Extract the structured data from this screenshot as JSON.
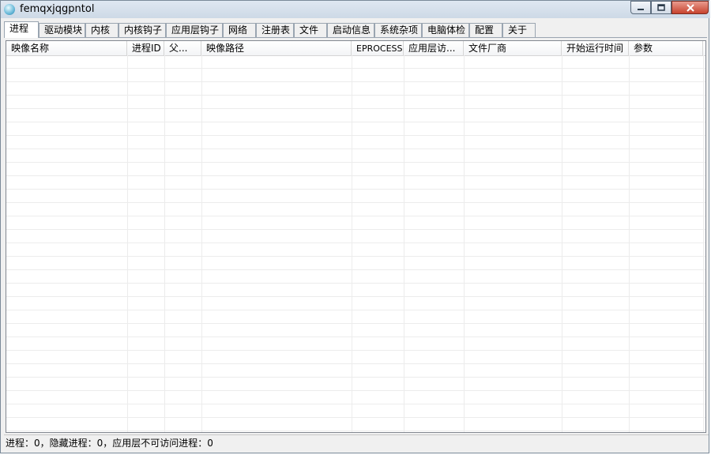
{
  "window": {
    "title": "femqxjqgpntol",
    "controls": {
      "minimize": "minimize-icon",
      "maximize": "maximize-icon",
      "close": "close-icon"
    }
  },
  "tabs": [
    {
      "label": "进程",
      "active": true
    },
    {
      "label": "驱动模块"
    },
    {
      "label": "内核"
    },
    {
      "label": "内核钩子"
    },
    {
      "label": "应用层钩子"
    },
    {
      "label": "网络"
    },
    {
      "label": "注册表"
    },
    {
      "label": "文件"
    },
    {
      "label": "启动信息"
    },
    {
      "label": "系统杂项"
    },
    {
      "label": "电脑体检"
    },
    {
      "label": "配置"
    },
    {
      "label": "关于"
    }
  ],
  "table": {
    "columns": [
      {
        "label": "映像名称"
      },
      {
        "label": "进程ID"
      },
      {
        "label": "父..."
      },
      {
        "label": "映像路径"
      },
      {
        "label": "EPROCESS"
      },
      {
        "label": "应用层访..."
      },
      {
        "label": "文件厂商"
      },
      {
        "label": "开始运行时间"
      },
      {
        "label": "参数"
      }
    ],
    "rows": []
  },
  "status": {
    "text": "进程：0，隐藏进程：0，应用层不可访问进程：0"
  }
}
